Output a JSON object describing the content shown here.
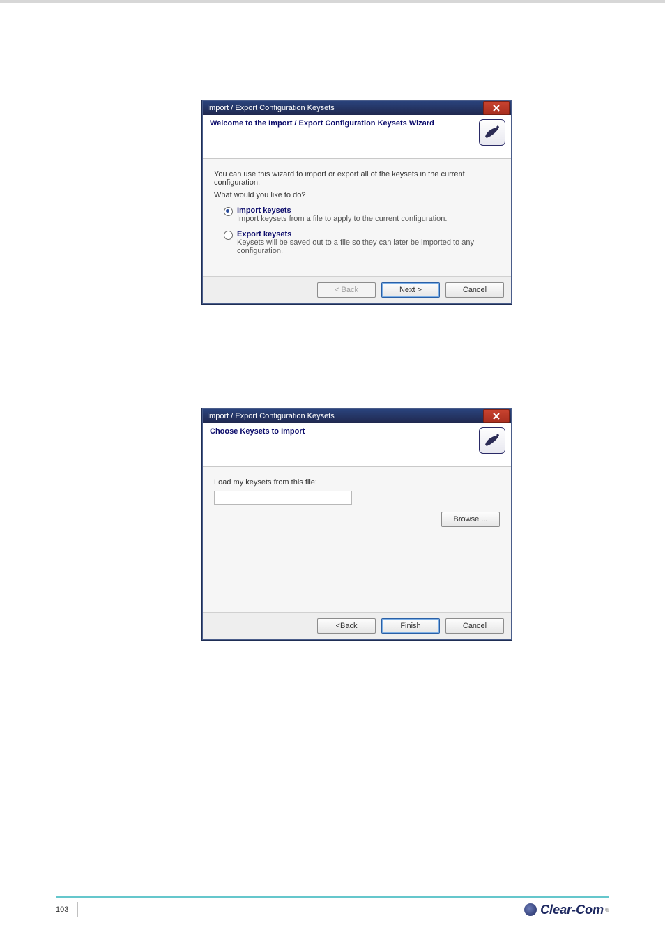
{
  "dialog1": {
    "title": "Import / Export Configuration Keysets",
    "heading": "Welcome to the Import / Export Configuration Keysets Wizard",
    "intro": "You can use this wizard to import or export all of the keysets in the current configuration.",
    "question": "What would you like to do?",
    "options": [
      {
        "title": "Import keysets",
        "desc": "Import keysets from a file to apply to the current configuration.",
        "selected": true
      },
      {
        "title": "Export keysets",
        "desc": "Keysets will be saved out to a file so they can later be imported to any configuration.",
        "selected": false
      }
    ],
    "buttons": {
      "back": "< Back",
      "next": "Next >",
      "cancel": "Cancel"
    }
  },
  "dialog2": {
    "title": "Import / Export Configuration Keysets",
    "heading": "Choose Keysets to Import",
    "prompt": "Load my keysets from this file:",
    "file_value": "",
    "browse": "Browse ...",
    "buttons": {
      "back_pre": "< ",
      "back_u": "B",
      "back_post": "ack",
      "finish_pre": "Fi",
      "finish_u": "n",
      "finish_post": "ish",
      "cancel": "Cancel"
    }
  },
  "footer": {
    "page": "103",
    "brand": "Clear-Com",
    "tm": "®"
  }
}
